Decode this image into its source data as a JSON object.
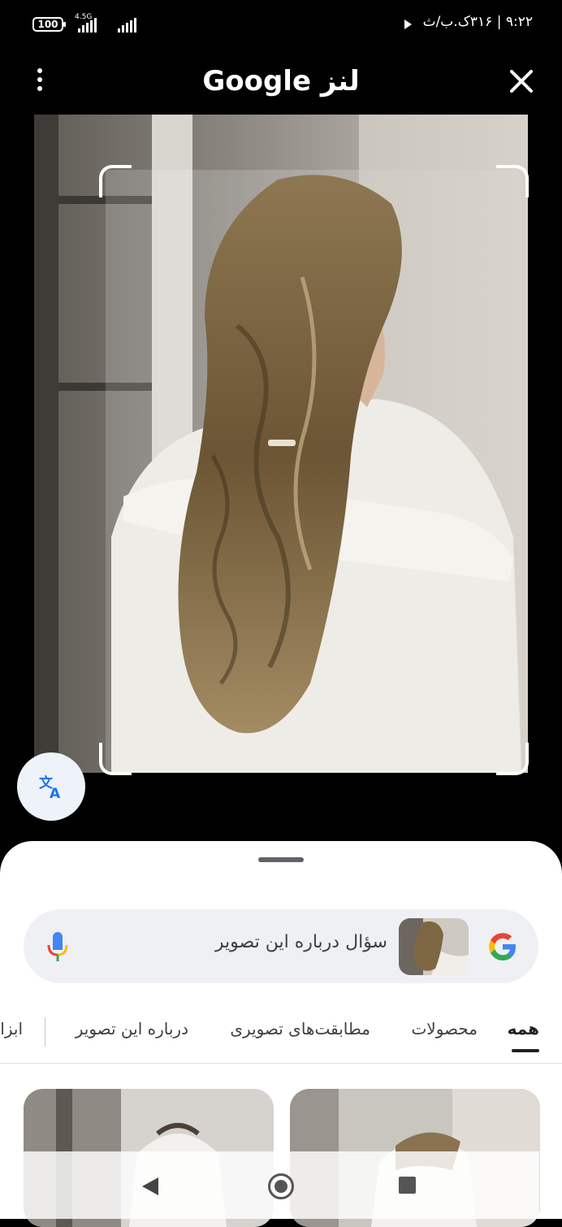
{
  "status_bar": {
    "battery": "100",
    "network": "4.5G",
    "time": "۹:۲۲ | ۳۱۶ک.ب/ث"
  },
  "header": {
    "title": "Google لنز",
    "more_icon": "more-vert-icon",
    "close_icon": "close-icon"
  },
  "translate_button": {
    "icon": "translate-icon"
  },
  "search": {
    "placeholder": "سؤال درباره این تصویر",
    "logo": "google-g-logo",
    "mic_icon": "mic-icon"
  },
  "tabs": [
    {
      "label": "همه",
      "active": true
    },
    {
      "label": "محصولات",
      "active": false
    },
    {
      "label": "مطابقت‌های تصویری",
      "active": false
    },
    {
      "label": "درباره این تصویر",
      "active": false
    },
    {
      "label": "ابزا",
      "active": false
    }
  ],
  "nav": {
    "back": "back-icon",
    "home": "home-icon",
    "recents": "recents-icon"
  },
  "colors": {
    "background": "#000000",
    "sheet": "#ffffff",
    "search_bar": "#eef0f4",
    "active_tab_underline": "#202124"
  }
}
